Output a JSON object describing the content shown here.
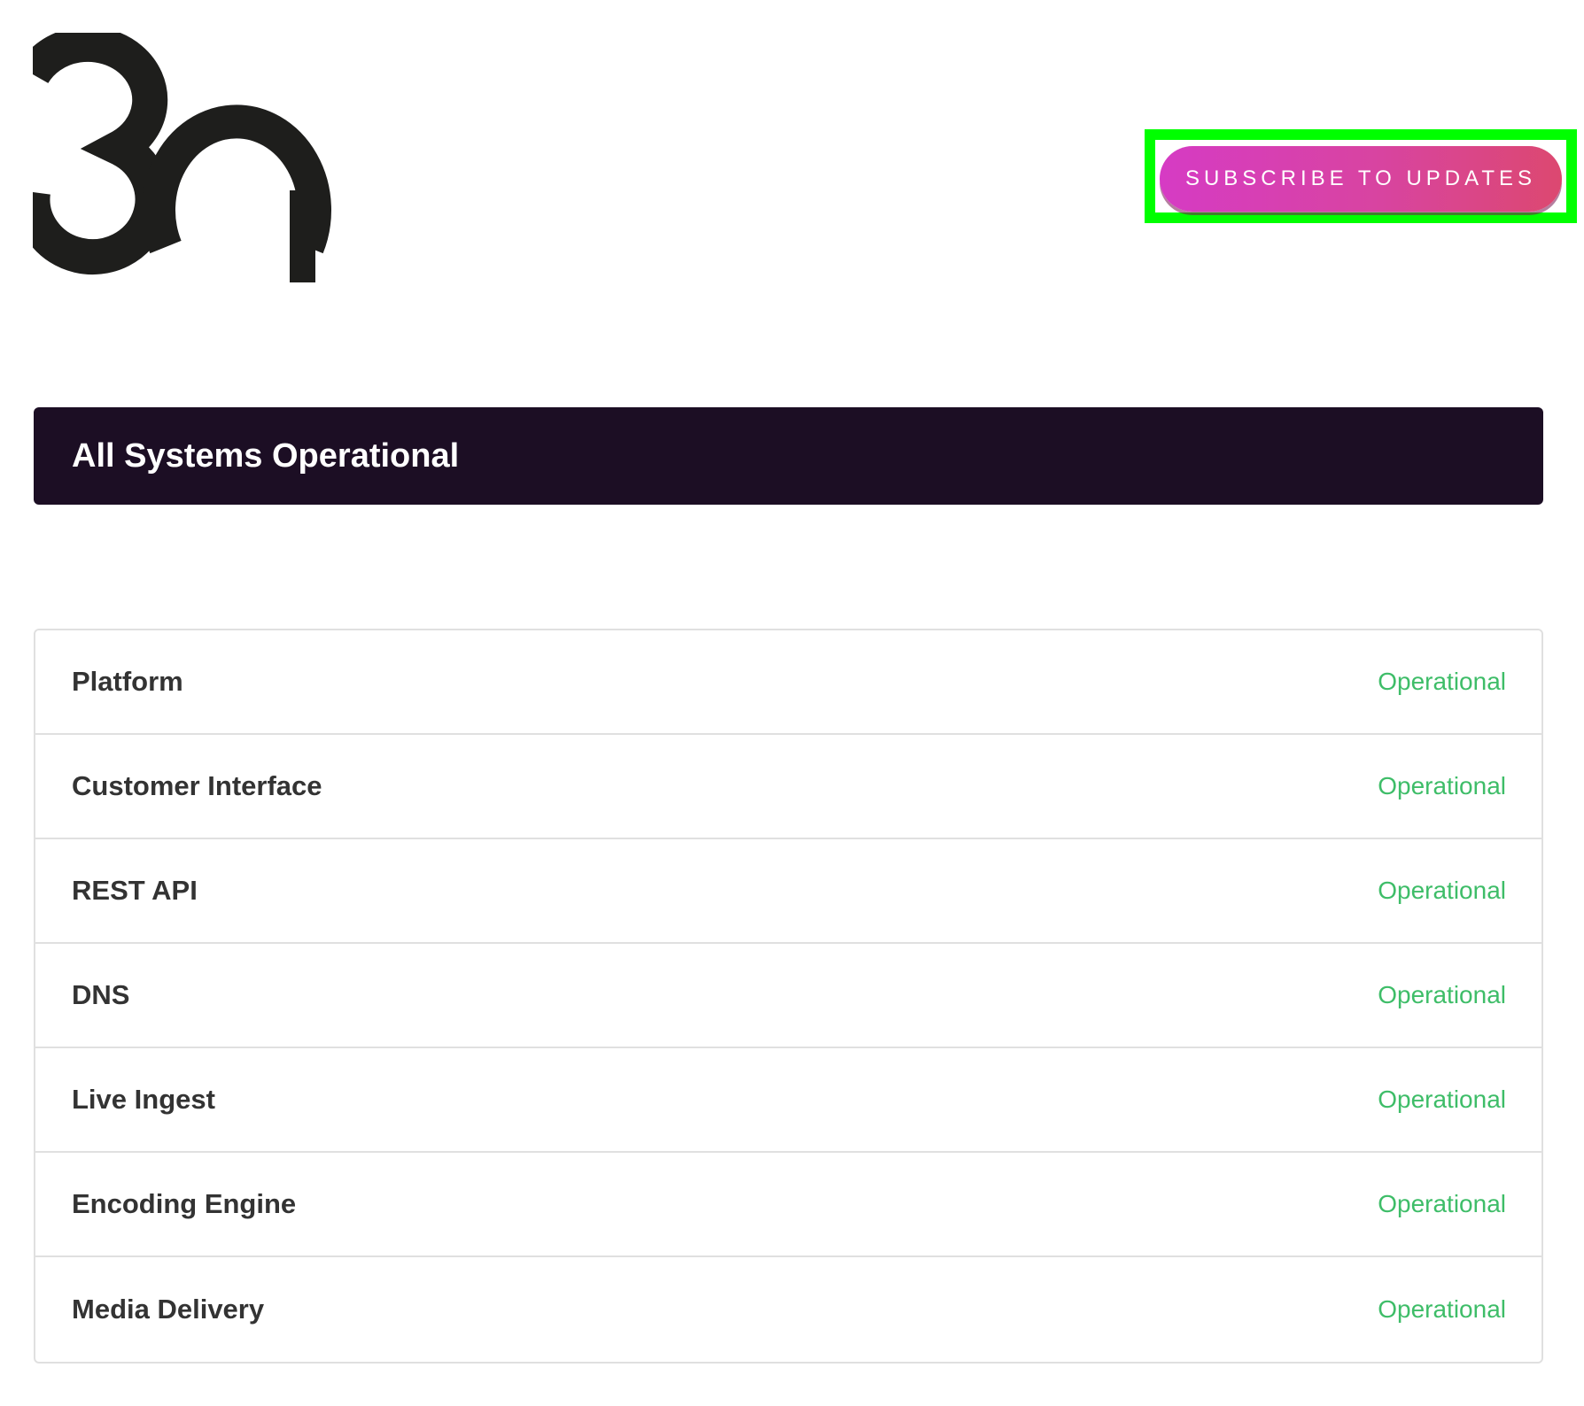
{
  "brand": {
    "logo_text": "3Q"
  },
  "header": {
    "subscribe_label": "Subscribe to Updates",
    "subscribe_gradient": [
      "#d63bc4",
      "#dc4870"
    ],
    "highlight_color": "#00ff00"
  },
  "status_banner": {
    "text": "All Systems Operational",
    "background": "#1c0e24"
  },
  "components": {
    "status_color": "#3ebd68",
    "items": [
      {
        "name": "Platform",
        "status": "Operational"
      },
      {
        "name": "Customer Interface",
        "status": "Operational"
      },
      {
        "name": "REST API",
        "status": "Operational"
      },
      {
        "name": "DNS",
        "status": "Operational"
      },
      {
        "name": "Live Ingest",
        "status": "Operational"
      },
      {
        "name": "Encoding Engine",
        "status": "Operational"
      },
      {
        "name": "Media Delivery",
        "status": "Operational"
      }
    ]
  }
}
